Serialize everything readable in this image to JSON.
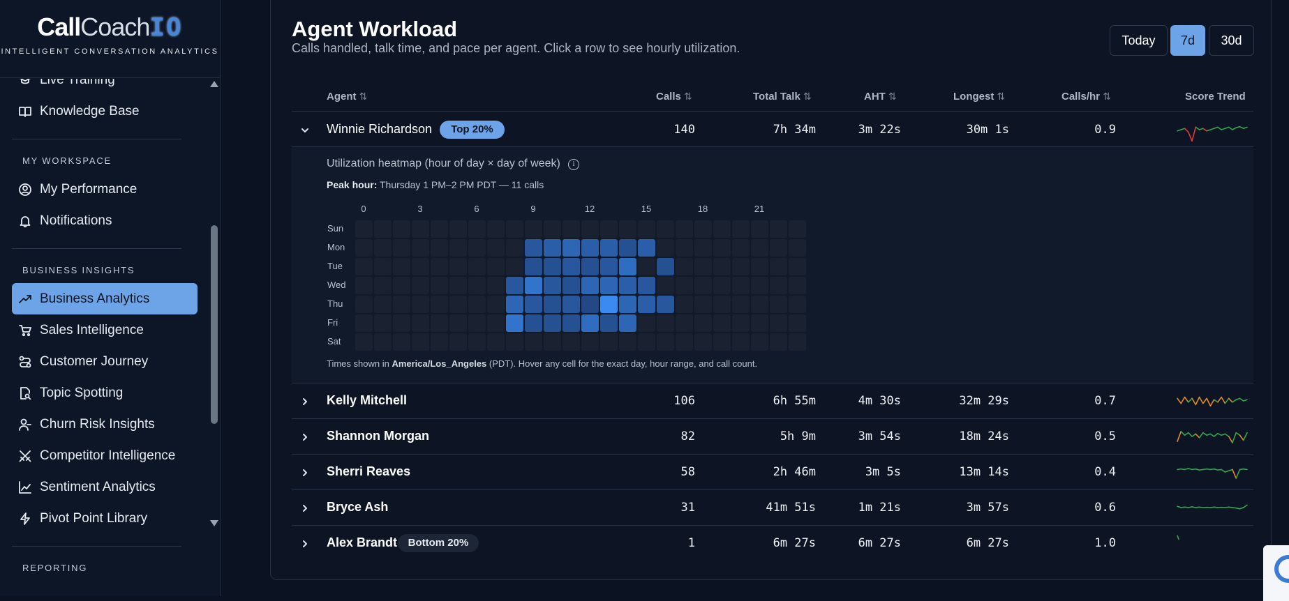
{
  "brand": {
    "name_a": "Call",
    "name_b": "Coach",
    "name_c": "IO",
    "tagline": "INTELLIGENT CONVERSATION ANALYTICS"
  },
  "sidebar": {
    "partial_item": "Live Training",
    "knowledge_base": "Knowledge Base",
    "section_workspace": "MY WORKSPACE",
    "my_performance": "My Performance",
    "notifications": "Notifications",
    "section_insights": "BUSINESS INSIGHTS",
    "insights": [
      {
        "label": "Business Analytics",
        "icon": "trend-up-icon",
        "active": true
      },
      {
        "label": "Sales Intelligence",
        "icon": "cart-icon",
        "active": false
      },
      {
        "label": "Customer Journey",
        "icon": "route-icon",
        "active": false
      },
      {
        "label": "Topic Spotting",
        "icon": "file-search-icon",
        "active": false
      },
      {
        "label": "Churn Risk Insights",
        "icon": "user-minus-icon",
        "active": false
      },
      {
        "label": "Competitor Intelligence",
        "icon": "swords-icon",
        "active": false
      },
      {
        "label": "Sentiment Analytics",
        "icon": "line-chart-icon",
        "active": false
      },
      {
        "label": "Pivot Point Library",
        "icon": "bolt-icon",
        "active": false
      }
    ],
    "section_reporting": "REPORTING"
  },
  "header": {
    "title": "Agent Workload",
    "subtitle": "Calls handled, talk time, and pace per agent. Click a row to see hourly utilization.",
    "ranges": [
      "Today",
      "7d",
      "30d"
    ],
    "active_range": "7d"
  },
  "table": {
    "columns": {
      "agent": "Agent",
      "calls": "Calls",
      "total_talk": "Total Talk",
      "aht": "AHT",
      "longest": "Longest",
      "calls_hr": "Calls/hr",
      "score_trend": "Score Trend"
    },
    "sort_glyph": "⇅",
    "rows": [
      {
        "name": "Winnie Richardson",
        "badge": "Top 20%",
        "calls": "140",
        "talk": "7h 34m",
        "aht": "3m 22s",
        "longest": "30m 1s",
        "rate": "0.9",
        "expanded": true,
        "trend": [
          [
            0.55,
            "#2fa84f"
          ],
          [
            0.5,
            "#2fa84f"
          ],
          [
            0.45,
            "#2fa84f"
          ],
          [
            0.6,
            "#e03a3a"
          ],
          [
            0.95,
            "#e03a3a"
          ],
          [
            0.4,
            "#e03a3a"
          ],
          [
            0.5,
            "#2fa84f"
          ],
          [
            0.45,
            "#2fa84f"
          ],
          [
            0.55,
            "#e03a3a"
          ],
          [
            0.5,
            "#2fa84f"
          ],
          [
            0.45,
            "#2fa84f"
          ],
          [
            0.4,
            "#2fa84f"
          ],
          [
            0.5,
            "#2fa84f"
          ],
          [
            0.45,
            "#2fa84f"
          ],
          [
            0.4,
            "#2fa84f"
          ],
          [
            0.5,
            "#2fa84f"
          ],
          [
            0.42,
            "#2fa84f"
          ],
          [
            0.38,
            "#2fa84f"
          ],
          [
            0.45,
            "#2fa84f"
          ],
          [
            0.4,
            "#2fa84f"
          ]
        ]
      },
      {
        "name": "Kelly Mitchell",
        "badge": "",
        "calls": "106",
        "talk": "6h 55m",
        "aht": "4m 30s",
        "longest": "32m 29s",
        "rate": "0.7",
        "expanded": false,
        "trend": [
          [
            0.4,
            "#e38a2a"
          ],
          [
            0.6,
            "#e38a2a"
          ],
          [
            0.35,
            "#e38a2a"
          ],
          [
            0.55,
            "#e38a2a"
          ],
          [
            0.4,
            "#2fa84f"
          ],
          [
            0.65,
            "#e38a2a"
          ],
          [
            0.35,
            "#e38a2a"
          ],
          [
            0.6,
            "#e38a2a"
          ],
          [
            0.4,
            "#e38a2a"
          ],
          [
            0.7,
            "#e38a2a"
          ],
          [
            0.45,
            "#e38a2a"
          ],
          [
            0.55,
            "#2fa84f"
          ],
          [
            0.35,
            "#e38a2a"
          ],
          [
            0.6,
            "#e38a2a"
          ],
          [
            0.4,
            "#2fa84f"
          ],
          [
            0.55,
            "#e38a2a"
          ],
          [
            0.45,
            "#2fa84f"
          ],
          [
            0.4,
            "#2fa84f"
          ],
          [
            0.5,
            "#2fa84f"
          ],
          [
            0.45,
            "#2fa84f"
          ]
        ]
      },
      {
        "name": "Shannon Morgan",
        "badge": "",
        "calls": "82",
        "talk": "5h 9m",
        "aht": "3m 54s",
        "longest": "18m 24s",
        "rate": "0.5",
        "expanded": false,
        "trend": [
          [
            0.7,
            "#e38a2a"
          ],
          [
            0.3,
            "#e38a2a"
          ],
          [
            0.45,
            "#2fa84f"
          ],
          [
            0.35,
            "#2fa84f"
          ],
          [
            0.5,
            "#2fa84f"
          ],
          [
            0.4,
            "#2fa84f"
          ],
          [
            0.55,
            "#e38a2a"
          ],
          [
            0.35,
            "#2fa84f"
          ],
          [
            0.45,
            "#2fa84f"
          ],
          [
            0.4,
            "#2fa84f"
          ],
          [
            0.5,
            "#2fa84f"
          ],
          [
            0.38,
            "#2fa84f"
          ],
          [
            0.45,
            "#2fa84f"
          ],
          [
            0.4,
            "#2fa84f"
          ],
          [
            0.5,
            "#2fa84f"
          ],
          [
            0.75,
            "#e38a2a"
          ],
          [
            0.35,
            "#2fa84f"
          ],
          [
            0.45,
            "#2fa84f"
          ],
          [
            0.65,
            "#e38a2a"
          ],
          [
            0.35,
            "#2fa84f"
          ]
        ]
      },
      {
        "name": "Sherri Reaves",
        "badge": "",
        "calls": "58",
        "talk": "2h 46m",
        "aht": "3m 5s",
        "longest": "13m 14s",
        "rate": "0.4",
        "expanded": false,
        "trend": [
          [
            0.4,
            "#2fa84f"
          ],
          [
            0.38,
            "#2fa84f"
          ],
          [
            0.4,
            "#2fa84f"
          ],
          [
            0.36,
            "#2fa84f"
          ],
          [
            0.4,
            "#2fa84f"
          ],
          [
            0.38,
            "#2fa84f"
          ],
          [
            0.42,
            "#2fa84f"
          ],
          [
            0.4,
            "#2fa84f"
          ],
          [
            0.38,
            "#2fa84f"
          ],
          [
            0.4,
            "#2fa84f"
          ],
          [
            0.38,
            "#2fa84f"
          ],
          [
            0.42,
            "#2fa84f"
          ],
          [
            0.4,
            "#2fa84f"
          ],
          [
            0.5,
            "#2fa84f"
          ],
          [
            0.45,
            "#2fa84f"
          ],
          [
            0.4,
            "#2fa84f"
          ],
          [
            0.75,
            "#e38a2a"
          ],
          [
            0.4,
            "#2fa84f"
          ],
          [
            0.38,
            "#2fa84f"
          ],
          [
            0.4,
            "#2fa84f"
          ]
        ]
      },
      {
        "name": "Bryce Ash",
        "badge": "",
        "calls": "31",
        "talk": "41m 51s",
        "aht": "1m 21s",
        "longest": "3m 57s",
        "rate": "0.6",
        "expanded": false,
        "trend": [
          [
            0.45,
            "#2fa84f"
          ],
          [
            0.5,
            "#2fa84f"
          ],
          [
            0.48,
            "#2fa84f"
          ],
          [
            0.5,
            "#2fa84f"
          ],
          [
            0.47,
            "#2fa84f"
          ],
          [
            0.5,
            "#2fa84f"
          ],
          [
            0.48,
            "#2fa84f"
          ],
          [
            0.5,
            "#2fa84f"
          ],
          [
            0.49,
            "#2fa84f"
          ],
          [
            0.5,
            "#2fa84f"
          ],
          [
            0.48,
            "#2fa84f"
          ],
          [
            0.5,
            "#2fa84f"
          ],
          [
            0.49,
            "#2fa84f"
          ],
          [
            0.5,
            "#2fa84f"
          ],
          [
            0.48,
            "#2fa84f"
          ],
          [
            0.5,
            "#2fa84f"
          ],
          [
            0.52,
            "#2fa84f"
          ],
          [
            0.55,
            "#2fa84f"
          ],
          [
            0.5,
            "#2fa84f"
          ],
          [
            0.4,
            "#2fa84f"
          ]
        ]
      },
      {
        "name": "Alex Brandt",
        "badge": "Bottom 20%",
        "calls": "1",
        "talk": "6m 27s",
        "aht": "6m 27s",
        "longest": "6m 27s",
        "rate": "1.0",
        "expanded": false,
        "trend": [
          [
            0.2,
            "#2fa84f"
          ],
          [
            0.35,
            "#2fa84f"
          ]
        ]
      }
    ]
  },
  "heatmap": {
    "title": "Utilization heatmap (hour of day × day of week)",
    "peak_label": "Peak hour:",
    "peak_value": "Thursday 1 PM–2 PM PDT — 11 calls",
    "hour_labels": [
      "0",
      "3",
      "6",
      "9",
      "12",
      "15",
      "18",
      "21"
    ],
    "days": [
      "Sun",
      "Mon",
      "Tue",
      "Wed",
      "Thu",
      "Fri",
      "Sat"
    ],
    "values": [
      [
        0,
        0,
        0,
        0,
        0,
        0,
        0,
        0,
        0,
        0,
        0,
        0,
        0,
        0,
        0,
        0,
        0,
        0,
        0,
        0,
        0,
        0,
        0,
        0
      ],
      [
        0,
        0,
        0,
        0,
        0,
        0,
        0,
        0,
        0,
        4,
        5,
        6,
        5,
        5,
        3,
        5,
        0,
        0,
        0,
        0,
        0,
        0,
        0,
        0
      ],
      [
        0,
        0,
        0,
        0,
        0,
        0,
        0,
        0,
        0,
        3,
        3,
        4,
        3,
        4,
        7,
        0,
        3,
        0,
        0,
        0,
        0,
        0,
        0,
        0
      ],
      [
        0,
        0,
        0,
        0,
        0,
        0,
        0,
        0,
        4,
        8,
        4,
        3,
        6,
        6,
        5,
        4,
        0,
        0,
        0,
        0,
        0,
        0,
        0,
        0
      ],
      [
        0,
        0,
        0,
        0,
        0,
        0,
        0,
        0,
        6,
        4,
        3,
        4,
        2,
        11,
        6,
        5,
        4,
        0,
        0,
        0,
        0,
        0,
        0,
        0
      ],
      [
        0,
        0,
        0,
        0,
        0,
        0,
        0,
        0,
        8,
        3,
        3,
        3,
        7,
        3,
        6,
        0,
        0,
        0,
        0,
        0,
        0,
        0,
        0,
        0
      ],
      [
        0,
        0,
        0,
        0,
        0,
        0,
        0,
        0,
        0,
        0,
        0,
        0,
        0,
        0,
        0,
        0,
        0,
        0,
        0,
        0,
        0,
        0,
        0,
        0
      ]
    ],
    "note_a": "Times shown in ",
    "note_tz": "America/Los_Angeles",
    "note_b": " (PDT). Hover any cell for the exact day, hour range, and call count."
  }
}
